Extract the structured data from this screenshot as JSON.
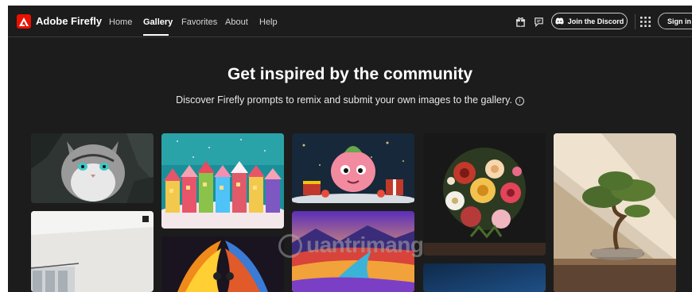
{
  "header": {
    "brand": "Adobe Firefly",
    "nav": [
      {
        "label": "Home"
      },
      {
        "label": "Gallery",
        "active": true
      },
      {
        "label": "Favorites"
      },
      {
        "label": "About"
      },
      {
        "label": "Help"
      }
    ],
    "discord_label": "Join the Discord",
    "signin_label": "Sign in",
    "icons": [
      "gift-icon",
      "chat-icon",
      "discord-icon",
      "apps-grid-icon"
    ]
  },
  "hero": {
    "title": "Get inspired by the community",
    "subtitle": "Discover Firefly prompts to remix and submit your own images to the gallery.",
    "info_glyph": "i"
  },
  "watermark": "uantrimang",
  "colors": {
    "background": "#1c1c1c",
    "brand_red": "#eb1000",
    "text": "#ffffff"
  }
}
